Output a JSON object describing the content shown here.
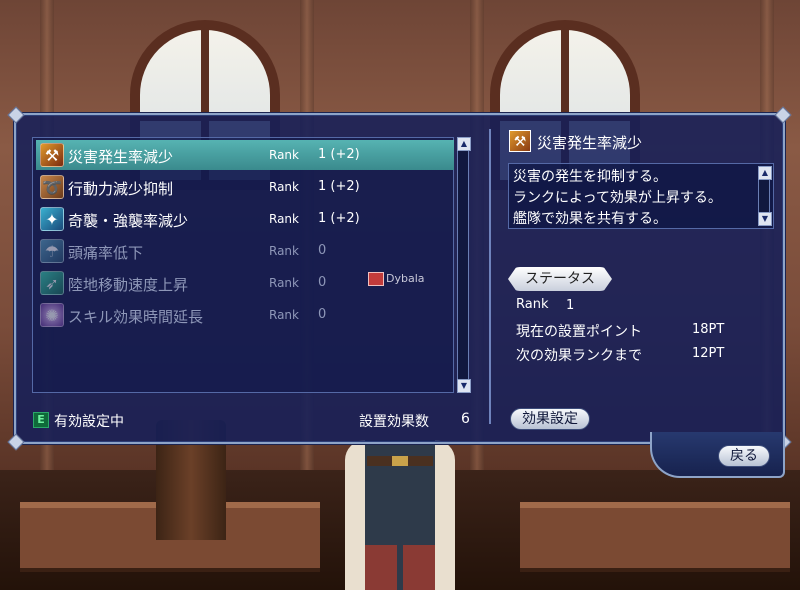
{
  "skills": [
    {
      "name": "災害発生率減少",
      "rank_label": "Rank",
      "rank": "1 (+2)",
      "icon": "disaster-icon",
      "active": true,
      "selected": true
    },
    {
      "name": "行動力減少抑制",
      "rank_label": "Rank",
      "rank": "1 (+2)",
      "icon": "horn-icon",
      "active": true,
      "selected": false
    },
    {
      "name": "奇襲・強襲率減少",
      "rank_label": "Rank",
      "rank": "1 (+2)",
      "icon": "sparkle-skull-icon",
      "active": true,
      "selected": false
    },
    {
      "name": "頭痛率低下",
      "rank_label": "Rank",
      "rank": "0",
      "icon": "running-figure-icon",
      "active": false,
      "selected": false
    },
    {
      "name": "陸地移動速度上昇",
      "rank_label": "Rank",
      "rank": "0",
      "icon": "runner-icon",
      "active": false,
      "selected": false
    },
    {
      "name": "スキル効果時間延長",
      "rank_label": "Rank",
      "rank": "0",
      "icon": "starburst-icon",
      "active": false,
      "selected": false
    }
  ],
  "player_name": "Dybala",
  "footer": {
    "e_badge": "E",
    "status": "有効設定中",
    "count_label": "設置効果数",
    "count": "6"
  },
  "detail": {
    "title": "災害発生率減少",
    "description": [
      "災害の発生を抑制する。",
      "ランクによって効果が上昇する。",
      "艦隊で効果を共有する。"
    ],
    "status_header": "ステータス",
    "rank_label": "Rank",
    "rank_value": "1",
    "current_points_label": "現在の設置ポイント",
    "current_points": "18PT",
    "next_rank_label": "次の効果ランクまで",
    "next_rank_points": "12PT",
    "effect_button": "効果設定"
  },
  "back_button": "戻る",
  "colors": {
    "panel": "#141e5a",
    "selected_row": "#4aa3a4",
    "inactive_text": "#8e97b8"
  }
}
